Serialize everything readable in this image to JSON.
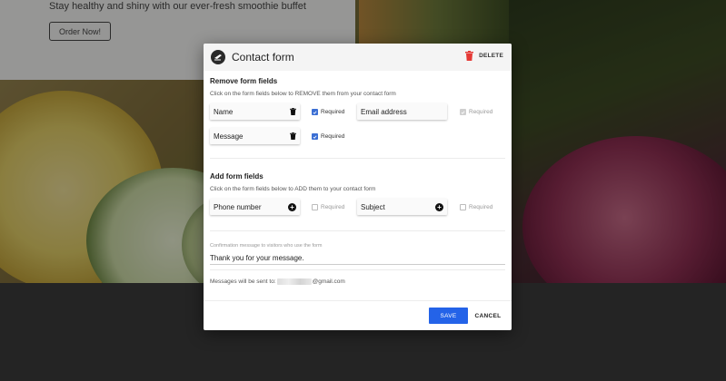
{
  "background": {
    "tagline": "Stay healthy and shiny with our ever-fresh smoothie buffet",
    "order_button": "Order Now!"
  },
  "modal": {
    "title": "Contact form",
    "logo_icon": "contact-form-icon",
    "delete_label": "DELETE",
    "remove_section": {
      "title": "Remove form fields",
      "description": "Click on the form fields below to REMOVE them from your contact form",
      "fields": [
        {
          "label": "Name",
          "icon": "trash-icon",
          "required_label": "Required",
          "required": true,
          "locked": false
        },
        {
          "label": "Email address",
          "icon": "",
          "required_label": "Required",
          "required": true,
          "locked": true
        },
        {
          "label": "Message",
          "icon": "trash-icon",
          "required_label": "Required",
          "required": true,
          "locked": false
        }
      ]
    },
    "add_section": {
      "title": "Add form fields",
      "description": "Click on the form fields below to ADD them to your contact form",
      "fields": [
        {
          "label": "Phone number",
          "icon": "plus-icon",
          "required_label": "Required",
          "required": false
        },
        {
          "label": "Subject",
          "icon": "plus-icon",
          "required_label": "Required",
          "required": false
        }
      ]
    },
    "confirmation": {
      "caption": "Confirmation message to visitors who use the form",
      "value": "Thank you for your message."
    },
    "send_to": {
      "prefix": "Messages will be sent to:",
      "suffix": "@gmail.com"
    },
    "save_label": "SAVE",
    "cancel_label": "CANCEL"
  },
  "colors": {
    "accent": "#2463e8",
    "checkbox_checked": "#3b6fd4",
    "delete_icon": "#e53935"
  }
}
